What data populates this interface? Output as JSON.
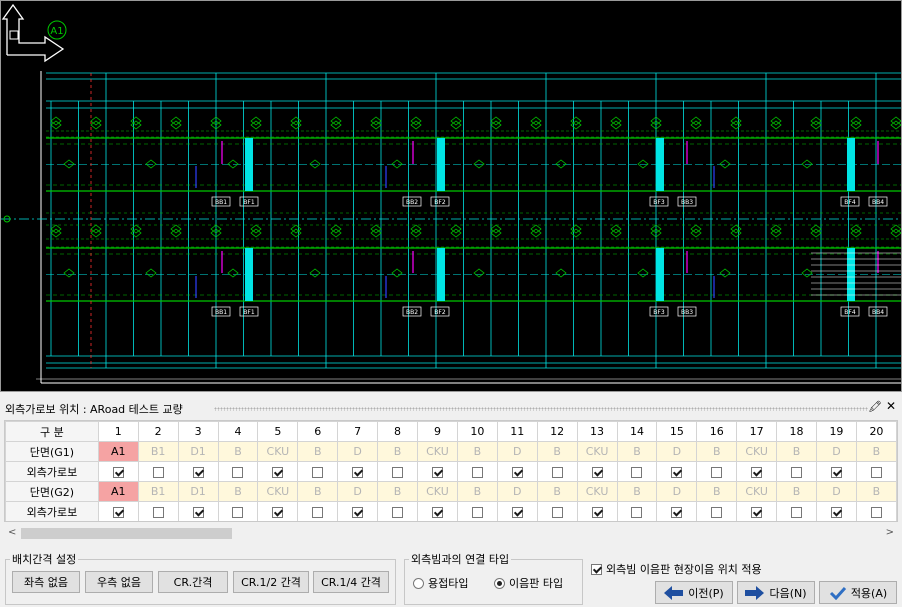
{
  "drawing": {
    "grid_bubble": "A1",
    "tags_top_row": [
      "BB1",
      "BF1",
      "BB2",
      "BF2",
      "BF3",
      "BB3",
      "BF4",
      "BB4"
    ],
    "tags_bottom_row": [
      "BB1",
      "BF1",
      "BB2",
      "BF2",
      "BF3",
      "BB3",
      "BF4",
      "BB4"
    ],
    "colors": {
      "background": "#000000",
      "structure": "#00e5e5",
      "girder": "#00c800",
      "dim": "#ffffff",
      "accent": "#ff00ff",
      "marker": "#ff3030",
      "blue": "#3040ff"
    }
  },
  "panel": {
    "title": "외측가로보 위치 : ARoad 테스트 교량",
    "pin_icon": "pin-icon",
    "close_icon": "close-icon"
  },
  "table": {
    "header_label": "구 분",
    "columns": [
      "1",
      "2",
      "3",
      "4",
      "5",
      "6",
      "7",
      "8",
      "9",
      "10",
      "11",
      "12",
      "13",
      "14",
      "15",
      "16",
      "17",
      "18",
      "19",
      "20"
    ],
    "rows": [
      {
        "label": "단면(G1)",
        "kind": "section",
        "values": [
          "A1",
          "B1",
          "D1",
          "B",
          "CKU",
          "B",
          "D",
          "B",
          "CKU",
          "B",
          "D",
          "B",
          "CKU",
          "B",
          "D",
          "B",
          "CKU",
          "B",
          "D",
          "B"
        ]
      },
      {
        "label": "외측가로보",
        "kind": "check",
        "values": [
          true,
          false,
          true,
          false,
          true,
          false,
          true,
          false,
          true,
          false,
          true,
          false,
          true,
          false,
          true,
          false,
          true,
          false,
          true,
          false
        ]
      },
      {
        "label": "단면(G2)",
        "kind": "section",
        "values": [
          "A1",
          "B1",
          "D1",
          "B",
          "CKU",
          "B",
          "D",
          "B",
          "CKU",
          "B",
          "D",
          "B",
          "CKU",
          "B",
          "D",
          "B",
          "CKU",
          "B",
          "D",
          "B"
        ]
      },
      {
        "label": "외측가로보",
        "kind": "check",
        "values": [
          true,
          false,
          true,
          false,
          true,
          false,
          true,
          false,
          true,
          false,
          true,
          false,
          true,
          false,
          true,
          false,
          true,
          false,
          true,
          false
        ]
      }
    ]
  },
  "scrollbar": {
    "left": "<",
    "right": ">"
  },
  "spacing": {
    "legend": "배치간격 설정",
    "buttons": [
      "좌측 없음",
      "우측 없음",
      "CR.간격",
      "CR.1/2 간격",
      "CR.1/4 간격"
    ]
  },
  "connection": {
    "legend": "외측빔과의 연결 타입",
    "options": [
      {
        "label": "용접타입",
        "selected": false
      },
      {
        "label": "이음판 타입",
        "selected": true
      }
    ]
  },
  "option_check": {
    "label": "외측빔 이음판 현장이음 위치 적용",
    "checked": true
  },
  "nav": {
    "prev": "이전(P)",
    "next": "다음(N)",
    "apply": "적용(A)"
  }
}
